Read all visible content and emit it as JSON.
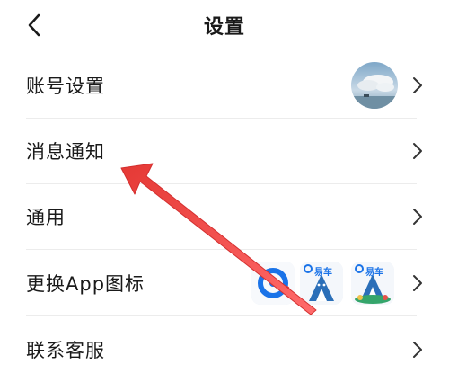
{
  "header": {
    "title": "设置"
  },
  "settings": {
    "items": [
      {
        "label": "账号设置"
      },
      {
        "label": "消息通知"
      },
      {
        "label": "通用"
      },
      {
        "label": "更换App图标"
      },
      {
        "label": "联系客服"
      }
    ]
  },
  "app_icons": {
    "brand_text": "易车"
  },
  "colors": {
    "annotation_arrow": "#e53935",
    "brand_blue": "#1a73e8",
    "divider": "#ececec"
  },
  "icons": {
    "back": "chevron-left-icon",
    "row_arrow": "chevron-right-icon"
  }
}
